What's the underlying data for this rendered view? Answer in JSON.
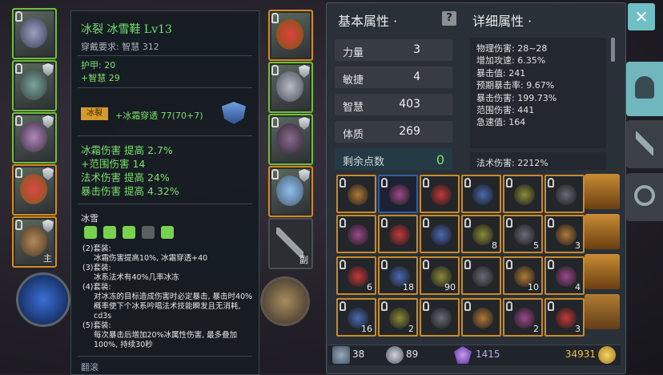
{
  "equipment": {
    "left_slot_badge": "主",
    "right_slot_badge": "副"
  },
  "tooltip": {
    "title": "冰裂  冰雪鞋 Lv13",
    "requirement": "穿戴要求:    智慧 312",
    "armor": "护甲:  20",
    "wisdom": "+智慧 29",
    "gem_tag": "冰裂",
    "gem_effect": "+冰霜穿透 77(70+7)",
    "bonuses": [
      "冰霜伤害 提高 2.7%",
      "+范围伤害 14",
      "法术伤害 提高 24%",
      "暴击伤害 提高 4.32%"
    ],
    "set_name": "冰雪",
    "set_bonuses": [
      {
        "label": "(2)套装:",
        "text": "冰霜伤害提高10%, 冰霜穿透+40"
      },
      {
        "label": "(3)套装:",
        "text": "冰系法术有40%几率冰冻"
      },
      {
        "label": "(4)套装:",
        "text": "对冰冻的目标造成伤害时必定暴击, 暴击时40%概率使下个冰系吟唱法术技能瞬发且无消耗, cd3s"
      },
      {
        "label": "(5)套装:",
        "text": "每次暴击后增加20%冰属性伤害, 最多叠加100%, 持续30秒"
      }
    ],
    "footer": "翻滚"
  },
  "stats": {
    "basic_title": "基本属性 ·",
    "detail_title": "详细属性 ·",
    "help_icon": "?",
    "close_icon": "✕",
    "basic": [
      {
        "label": "力量",
        "value": "3"
      },
      {
        "label": "敏捷",
        "value": "4"
      },
      {
        "label": "智慧",
        "value": "403"
      },
      {
        "label": "体质",
        "value": "269"
      }
    ],
    "remaining_label": "剩余点数",
    "remaining_value": "0",
    "details": [
      "物理伤害: 28~28",
      "增加攻速: 6.35%",
      "暴击值: 241",
      "预期暴击率: 9.67%",
      "暴击伤害: 199.73%",
      "范围伤害: 441",
      "急速值: 164"
    ],
    "spell_damage": "法术伤害: 2212%"
  },
  "inventory": {
    "rows": [
      [
        "",
        "",
        "",
        "",
        "",
        ""
      ],
      [
        "",
        "",
        "",
        "8",
        "5",
        "3"
      ],
      [
        "6",
        "18",
        "90",
        "",
        "10",
        "4"
      ],
      [
        "16",
        "2",
        "",
        "",
        "2",
        "3"
      ]
    ]
  },
  "footer_bar": {
    "sword_count": "38",
    "potion_count": "89",
    "crystal_count": "1415",
    "gold_count": "34931"
  },
  "colors": {
    "title_green": "#6fe36a",
    "panel_bg": "#2a3038",
    "close_btn": "#6fc0c5",
    "item_border": "#c98a26"
  }
}
